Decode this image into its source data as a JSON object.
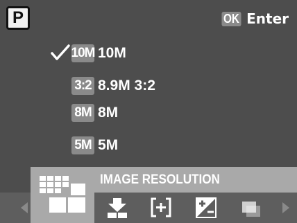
{
  "header": {
    "mode_label": "P",
    "ok_label": "OK",
    "enter_label": "Enter"
  },
  "menu": {
    "items": [
      {
        "chip": "10M",
        "label": "10M",
        "selected": true
      },
      {
        "chip": "3:2",
        "label": "8.9M 3:2",
        "selected": false
      },
      {
        "chip": "8M",
        "label": "8M",
        "selected": false
      },
      {
        "chip": "5M",
        "label": "5M",
        "selected": false
      }
    ]
  },
  "footer": {
    "title": "IMAGE RESOLUTION",
    "icons": [
      "image-resolution-icon",
      "download-icon",
      "focus-area-icon",
      "exposure-compensation-icon",
      "drive-mode-icon"
    ]
  },
  "colors": {
    "background": "#4d4d4d",
    "chip": "#8a8a8a",
    "highlight": "#a9a9a9",
    "strip": "#5e5e5e",
    "text": "#ffffff"
  }
}
